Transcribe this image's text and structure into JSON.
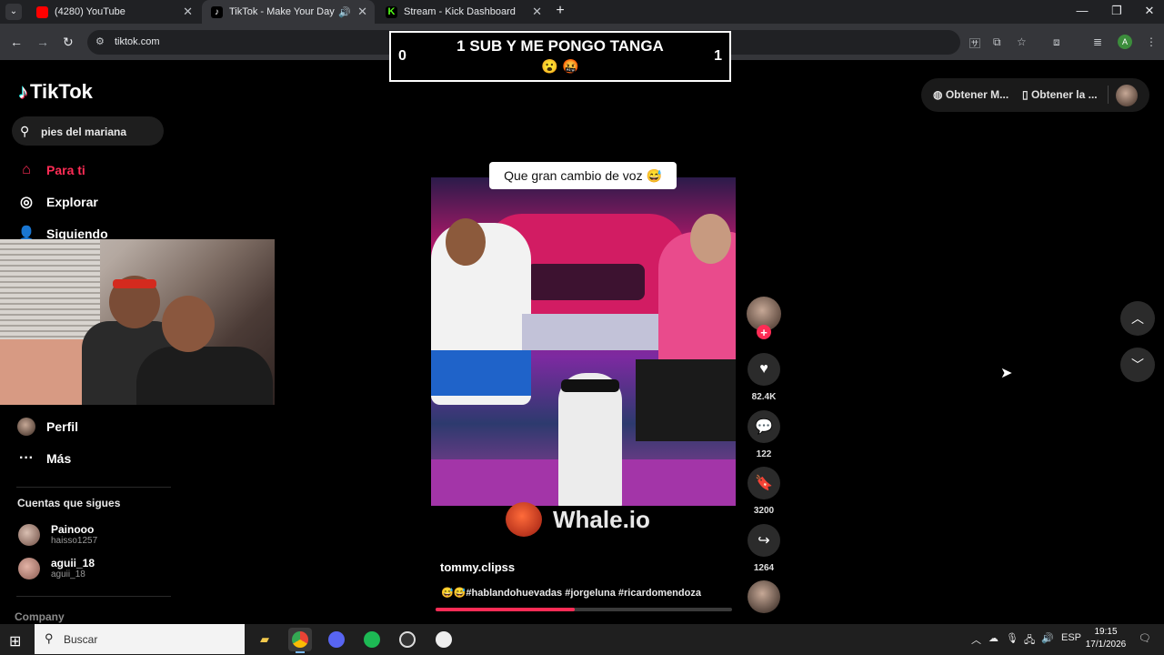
{
  "browser": {
    "tabs": [
      {
        "title": "(4280) YouTube",
        "icon": "youtube-icon",
        "color": "#ff0000"
      },
      {
        "title": "TikTok - Make Your Day",
        "icon": "tiktok-icon",
        "color": "#ffffff"
      },
      {
        "title": "Stream - Kick Dashboard",
        "icon": "kick-icon",
        "color": "#53fc18"
      }
    ],
    "new_tab": "+",
    "url": "tiktok.com"
  },
  "overlay": {
    "title": "1 SUB Y ME PONGO TANGA",
    "emojis": "😮 🤬",
    "score_left": "0",
    "score_right": "1"
  },
  "sidebar": {
    "logo": "TikTok",
    "search_value": "pies del mariana",
    "nav": [
      {
        "label": "Para ti",
        "icon": "home-icon"
      },
      {
        "label": "Explorar",
        "icon": "compass-icon"
      },
      {
        "label": "Siguiendo",
        "icon": "user-follow-icon"
      },
      {
        "label": "Perfil",
        "icon": "avatar"
      },
      {
        "label": "Más",
        "icon": "more-icon"
      }
    ],
    "following_title": "Cuentas que sigues",
    "following": [
      {
        "name": "Painooo",
        "handle": "haisso1257"
      },
      {
        "name": "aguii_18",
        "handle": "aguii_18"
      }
    ],
    "company": "Company"
  },
  "video": {
    "caption": "Que gran cambio de voz 😅",
    "watermark": "Whale.io",
    "author": "tommy.clipss",
    "description": "😅😅#hablandohuevadas #jorgeluna #ricardomendoza",
    "progress": 0.47
  },
  "actions": {
    "likes": "82.4K",
    "comments": "122",
    "saves": "3200",
    "shares": "1264"
  },
  "topright": {
    "btn1": "Obtener M...",
    "btn2": "Obtener la ..."
  },
  "taskbar": {
    "search_placeholder": "Buscar",
    "lang": "ESP",
    "time": "19:15",
    "date": "17/1/2026"
  },
  "colors": {
    "accent": "#fe2c55",
    "background": "#000000"
  }
}
